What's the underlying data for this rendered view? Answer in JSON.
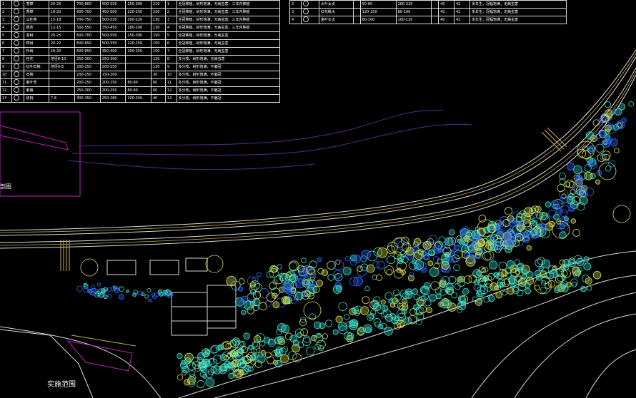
{
  "drawing": {
    "bottom_label": "实施范围",
    "side_label": "剖图"
  },
  "table_left": {
    "rows": [
      {
        "no": "1",
        "name": "香樟",
        "c2": "20-25",
        "c3": "700-800",
        "c4": "500-550",
        "c5": "250-300",
        "c6": "210",
        "c7": "1",
        "c8": "全冠移植，树形饱满，无病虫害，三年内移植"
      },
      {
        "no": "2",
        "name": "香樟",
        "c2": "18-20",
        "c3": "600-700",
        "c4": "450-500",
        "c5": "220-250",
        "c6": "230",
        "c7": "2",
        "c8": "全冠移植，树形饱满，无病虫害，三年内移植"
      },
      {
        "no": "3",
        "name": "山杜英",
        "c2": "15-18",
        "c3": "700-750",
        "c4": "500-520",
        "c5": "200-220",
        "c6": "130",
        "c7": "3",
        "c8": "全冠移植，树形饱满，无病虫害，三年内移植"
      },
      {
        "no": "4",
        "name": "银杏",
        "c2": "12-15",
        "c3": "500-550",
        "c4": "350-450",
        "c5": "180-200",
        "c6": "130",
        "c7": "4",
        "c8": "全冠移植，树形饱满，无病虫害，三年内移植"
      },
      {
        "no": "5",
        "name": "栾树",
        "c2": "20-25",
        "c3": "600-700",
        "c4": "500-550",
        "c5": "250-300",
        "c6": "150",
        "c7": "5",
        "c8": "全冠移植，树形饱满，无病虫害"
      },
      {
        "no": "6",
        "name": "榉树",
        "c2": "20-22",
        "c3": "600-650",
        "c4": "500-550",
        "c5": "220-250",
        "c6": "150",
        "c7": "6",
        "c8": "全冠移植，树形饱满，无病虫害"
      },
      {
        "no": "7",
        "name": "朴树",
        "c2": "18-20",
        "c3": "600-650",
        "c4": "350-400",
        "c5": "200-250",
        "c6": "150",
        "c7": "7",
        "c8": "全冠移植，树形饱满，无病虫害"
      },
      {
        "no": "8",
        "name": "桂花",
        "c2": "地径8-10",
        "c3": "250-300",
        "c4": "250-300",
        "c5": "",
        "c6": "120",
        "c7": "8",
        "c8": "多分枝，树形饱满，无病虫害"
      },
      {
        "no": "9",
        "name": "红叶石楠",
        "c2": "地径6-8",
        "c3": "200-250",
        "c4": "200-250",
        "c5": "",
        "c6": "130",
        "c7": "9",
        "c8": "多分枝，树形饱满，不偏冠"
      },
      {
        "no": "10",
        "name": "石楠",
        "c2": "",
        "c3": "200-250",
        "c4": "150-200",
        "c5": "",
        "c6": "30",
        "c7": "10",
        "c8": "多分枝，树形饱满，不偏冠"
      },
      {
        "no": "11",
        "name": "紫叶李",
        "c2": "",
        "c3": "200-250",
        "c4": "200-250",
        "c5": "80-90",
        "c6": "60",
        "c7": "11",
        "c8": "多分枝，树形饱满，不偏冠"
      },
      {
        "no": "12",
        "name": "紫薇",
        "c2": "",
        "c3": "250-300",
        "c4": "200-250",
        "c5": "80-90",
        "c6": "60",
        "c7": "12",
        "c8": "多分枝，树形饱满，不偏冠"
      },
      {
        "no": "13",
        "name": "碧桃",
        "c2": "7-8",
        "c3": "300-350",
        "c4": "250-280",
        "c5": "200-250",
        "c6": "40",
        "c7": "13",
        "c8": "多分枝，树形饱满，不偏冠"
      }
    ]
  },
  "table_right": {
    "rows": [
      {
        "no": "2",
        "name": "大叶女贞",
        "c2": "50-60",
        "c3": "200-220",
        "c6": "40",
        "c7": "42",
        "c8": "多年生，冠幅饱满，无病虫害"
      },
      {
        "no": "3",
        "name": "红花檵木",
        "c2": "120-150",
        "c3": "80-100",
        "c6": "40",
        "c7": "42",
        "c8": "多年生，冠幅饱满，无病虫害"
      },
      {
        "no": "4",
        "name": "金叶女贞",
        "c2": "80-100",
        "c3": "100-120",
        "c6": "40",
        "c7": "42",
        "c8": "多年生，冠幅饱满，无病虫害"
      }
    ]
  },
  "colors": {
    "background": "#000000",
    "tree_cyan": "#3fe0d0",
    "tree_blue": "#2f6bff",
    "tree_yellow": "#d8e04a",
    "road_white": "#d9d9d9",
    "magenta": "#c020c0"
  }
}
